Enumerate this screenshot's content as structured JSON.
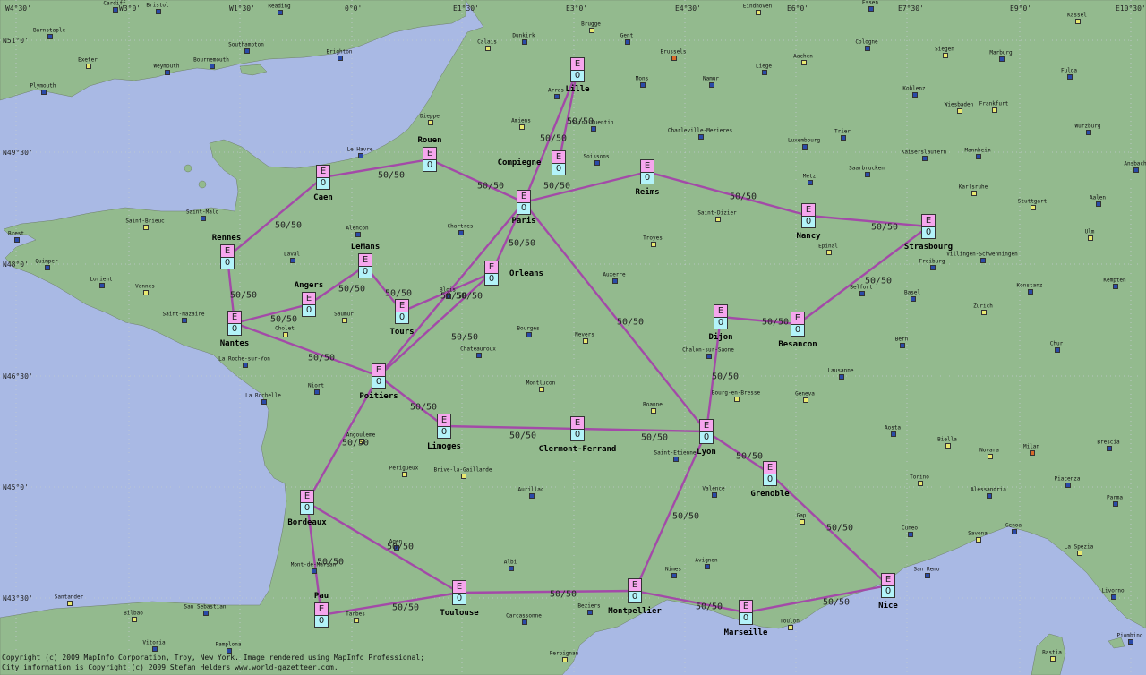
{
  "colors": {
    "sea": "#a9b9e4",
    "land": "#93ba8e",
    "route": "#a34aa8",
    "node_top": "#f6a6ee",
    "node_bottom": "#b3f3f9"
  },
  "node_top_label": "E",
  "node_bottom_label": "0",
  "coords": [
    "W4°30'",
    "W3°0'",
    "W1°30'",
    "0°0'",
    "E1°30'",
    "E3°0'",
    "E4°30'",
    "E6°0'",
    "E7°30'",
    "E9°0'",
    "E10°30'",
    "N51°0'",
    "N49°30'",
    "N48°0'",
    "N46°30'",
    "N45°0'",
    "N43°30'"
  ],
  "cities": [
    "Lille",
    "Rouen",
    "Caen",
    "Compiegne",
    "Reims",
    "Paris",
    "Nancy",
    "Strasbourg",
    "Rennes",
    "LeMans",
    "Orleans",
    "Angers",
    "Nantes",
    "Tours",
    "Dijon",
    "Besancon",
    "Poitiers",
    "Limoges",
    "Clermont-Ferrand",
    "Lyon",
    "Grenoble",
    "Bordeaux",
    "Pau",
    "Toulouse",
    "Montpellier",
    "Marseille",
    "Nice"
  ],
  "routes": [
    {
      "from": "Caen",
      "to": "Rouen",
      "label": "50/50"
    },
    {
      "from": "Rouen",
      "to": "Paris",
      "label": "50/50"
    },
    {
      "from": "Paris",
      "to": "Lille",
      "label": "50/50"
    },
    {
      "from": "Compiegne",
      "to": "Lille",
      "label": "50/50"
    },
    {
      "from": "Paris",
      "to": "Reims",
      "label": "50/50"
    },
    {
      "from": "Reims",
      "to": "Nancy",
      "label": "50/50"
    },
    {
      "from": "Nancy",
      "to": "Strasbourg",
      "label": "50/50"
    },
    {
      "from": "Strasbourg",
      "to": "Besancon",
      "label": "50/50"
    },
    {
      "from": "Dijon",
      "to": "Besancon",
      "label": "50/50"
    },
    {
      "from": "Dijon",
      "to": "Lyon",
      "label": "50/50"
    },
    {
      "from": "Paris",
      "to": "Lyon",
      "label": "50/50"
    },
    {
      "from": "Paris",
      "to": "Orleans",
      "label": "50/50"
    },
    {
      "from": "Caen",
      "to": "Rennes",
      "label": "50/50"
    },
    {
      "from": "Rennes",
      "to": "Nantes",
      "label": "50/50"
    },
    {
      "from": "Nantes",
      "to": "Angers",
      "label": "50/50"
    },
    {
      "from": "Angers",
      "to": "LeMans",
      "label": "50/50"
    },
    {
      "from": "LeMans",
      "to": "Tours",
      "label": "50/50"
    },
    {
      "from": "Tours",
      "to": "Orleans",
      "label": "50/50"
    },
    {
      "from": "Nantes",
      "to": "Poitiers",
      "label": "50/50"
    },
    {
      "from": "Orleans",
      "to": "Poitiers",
      "label": "50/50"
    },
    {
      "from": "Paris",
      "to": "Poitiers",
      "label": "50/50"
    },
    {
      "from": "Poitiers",
      "to": "Limoges",
      "label": "50/50"
    },
    {
      "from": "Poitiers",
      "to": "Bordeaux",
      "label": "50/50"
    },
    {
      "from": "Limoges",
      "to": "Clermont-Ferrand",
      "label": "50/50"
    },
    {
      "from": "Clermont-Ferrand",
      "to": "Lyon",
      "label": "50/50"
    },
    {
      "from": "Lyon",
      "to": "Grenoble",
      "label": "50/50"
    },
    {
      "from": "Lyon",
      "to": "Montpellier",
      "label": "50/50"
    },
    {
      "from": "Grenoble",
      "to": "Nice",
      "label": "50/50"
    },
    {
      "from": "Nice",
      "to": "Marseille",
      "label": "50/50"
    },
    {
      "from": "Marseille",
      "to": "Montpellier",
      "label": "50/50"
    },
    {
      "from": "Montpellier",
      "to": "Toulouse",
      "label": "50/50"
    },
    {
      "from": "Toulouse",
      "to": "Pau",
      "label": "50/50"
    },
    {
      "from": "Bordeaux",
      "to": "Pau",
      "label": "50/50"
    },
    {
      "from": "Bordeaux",
      "to": "Toulouse",
      "label": "50/50"
    }
  ],
  "basemap_labels": [
    "Barnstaple",
    "Exeter",
    "Plymouth",
    "Weymouth",
    "Bournemouth",
    "Southampton",
    "Brighton",
    "Reading",
    "Bristol",
    "Cardiff",
    "Calais",
    "Dunkirk",
    "Brugge",
    "Gent",
    "Brussels",
    "Mons",
    "Namur",
    "Liege",
    "Aachen",
    "Eindhoven",
    "Essen",
    "Cologne",
    "Siegen",
    "Marburg",
    "Kassel",
    "Fulda",
    "Koblenz",
    "Wiesbaden",
    "Frankfurt",
    "Mannheim",
    "Wurzburg",
    "Trier",
    "Luxembourg",
    "Metz",
    "Saarbrucken",
    "Kaiserslautern",
    "Karlsruhe",
    "Stuttgart",
    "Aalen",
    "Ulm",
    "Kempten",
    "Konstanz",
    "Zurich",
    "Bern",
    "Chur",
    "Basel",
    "Freiburg",
    "Villingen-Schwenningen",
    "Ansbach",
    "Dieppe",
    "Amiens",
    "Arras",
    "Saint-Quentin",
    "Soissons",
    "Charleville-Mezieres",
    "Le Havre",
    "Chartres",
    "Alencon",
    "Laval",
    "Saint-Malo",
    "Saint-Brieuc",
    "Brest",
    "Quimper",
    "Lorient",
    "Vannes",
    "Saint-Nazaire",
    "Cholet",
    "Saumur",
    "Blois",
    "Troyes",
    "Saint-Dizier",
    "Epinal",
    "Belfort",
    "Auxerre",
    "Nevers",
    "Bourges",
    "Chateauroux",
    "Montlucon",
    "Roanne",
    "Chalon-sur-Saone",
    "Bourg-en-Bresse",
    "Geneva",
    "Lausanne",
    "Aosta",
    "Biella",
    "Novara",
    "Milan",
    "Brescia",
    "Torino",
    "Alessandria",
    "Piacenza",
    "Parma",
    "Genoa",
    "La Spezia",
    "Savona",
    "Cuneo",
    "San Remo",
    "Livorno",
    "Piombino",
    "Bastia",
    "Gap",
    "Valence",
    "Avignon",
    "Nimes",
    "Toulon",
    "Beziers",
    "Carcassonne",
    "Perpignan",
    "Albi",
    "Agen",
    "Aurillac",
    "Brive-la-Gaillarde",
    "Perigueux",
    "Angouleme",
    "Niort",
    "La Rochelle",
    "La Roche-sur-Yon",
    "Mont-de-Marsan",
    "San Sebastian",
    "Santander",
    "Bilbao",
    "Vitoria",
    "Pamplona",
    "Tarbes",
    "Saint-Etienne"
  ],
  "copyright": [
    "Copyright (c) 2009 MapInfo Corporation, Troy, New York. Image rendered using MapInfo Professional;",
    "City information is Copyright (c) 2009 Stefan Helders www.world-gazetteer.com."
  ]
}
